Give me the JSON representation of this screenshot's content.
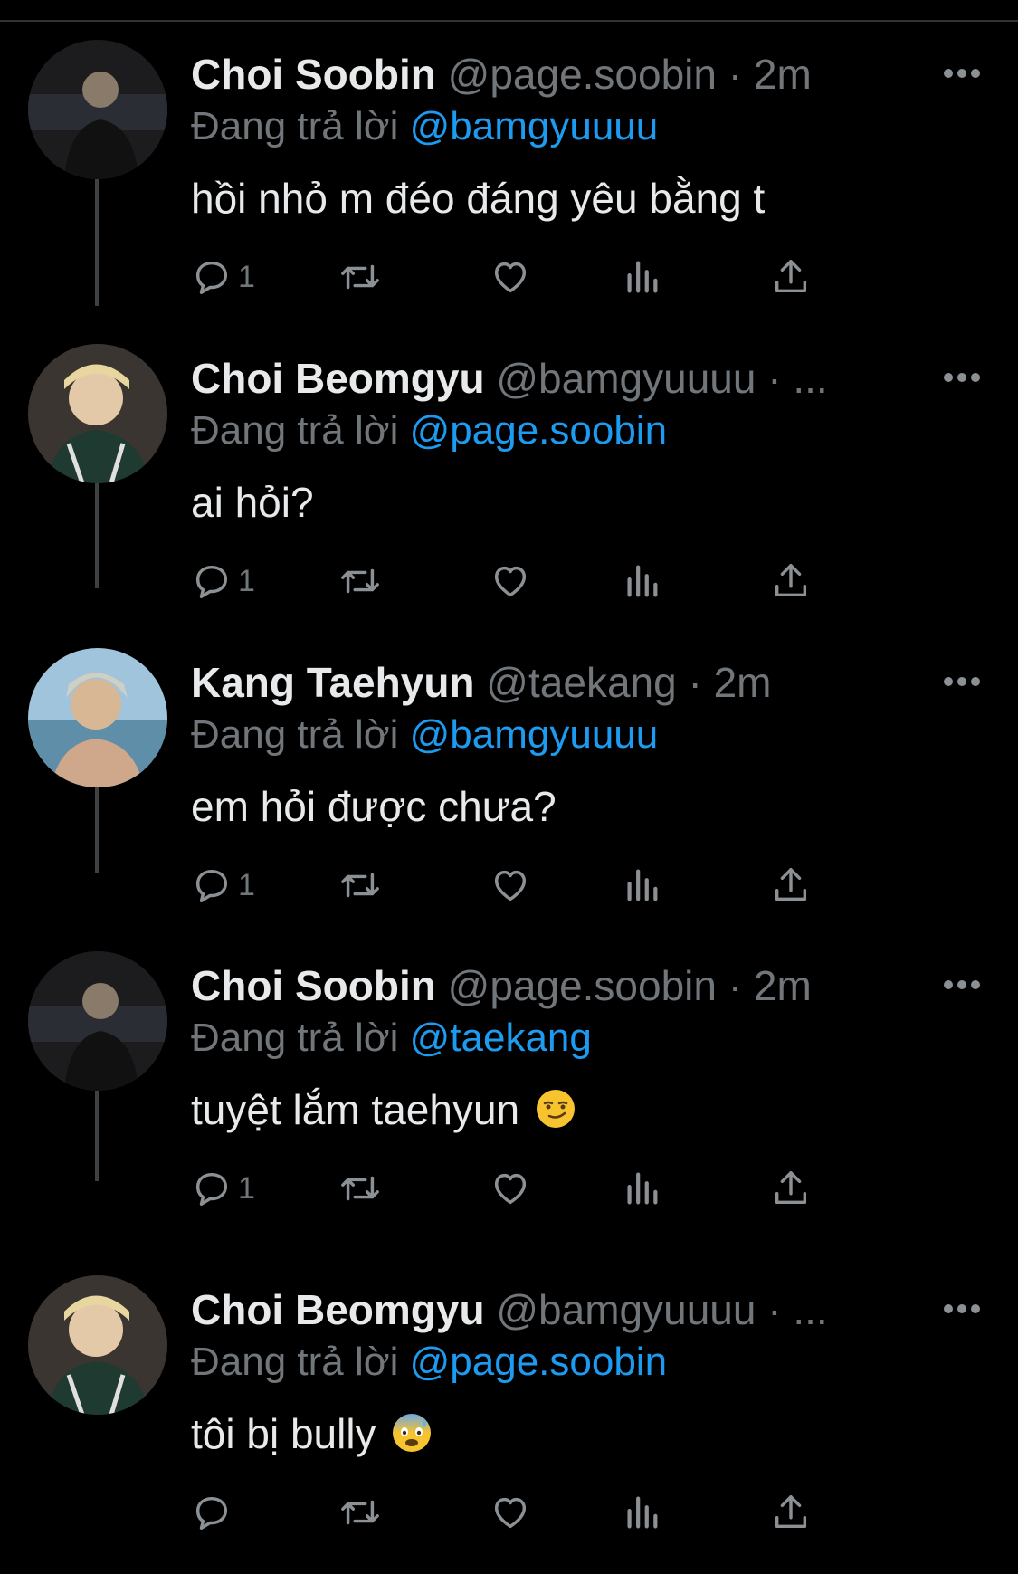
{
  "colors": {
    "background": "#000000",
    "text": "#e7e9ea",
    "muted": "#71767b",
    "link": "#1d9bf0",
    "divider": "#2f3336"
  },
  "thread": {
    "reply_prefix": "Đang trả lời",
    "more_icon": "more-horizontal-icon",
    "tweets": [
      {
        "name": "Choi Soobin",
        "handle": "@page.soobin",
        "dot": "·",
        "time": "2m",
        "reply_to": "@bamgyuuuu",
        "text": "hồi nhỏ m đéo đáng yêu bằng t",
        "emoji": "",
        "reply_count": "1"
      },
      {
        "name": "Choi Beomgyu",
        "handle": "@bamgyuuuu",
        "dot": "·",
        "time": "...",
        "reply_to": "@page.soobin",
        "text": "ai hỏi?",
        "emoji": "",
        "reply_count": "1"
      },
      {
        "name": "Kang Taehyun",
        "handle": "@taekang",
        "dot": "·",
        "time": "2m",
        "reply_to": "@bamgyuuuu",
        "text": "em hỏi được chưa?",
        "emoji": "",
        "reply_count": "1"
      },
      {
        "name": "Choi Soobin",
        "handle": "@page.soobin",
        "dot": "·",
        "time": "2m",
        "reply_to": "@taekang",
        "text": "tuyệt lắm taehyun",
        "emoji": "smirking-face",
        "reply_count": "1"
      },
      {
        "name": "Choi Beomgyu",
        "handle": "@bamgyuuuu",
        "dot": "·",
        "time": "...",
        "reply_to": "@page.soobin",
        "text": "tôi bị bully",
        "emoji": "anxious-face-with-sweat",
        "reply_count": ""
      }
    ]
  },
  "action_icons": [
    "reply-icon",
    "retweet-icon",
    "like-icon",
    "analytics-icon",
    "share-icon"
  ]
}
